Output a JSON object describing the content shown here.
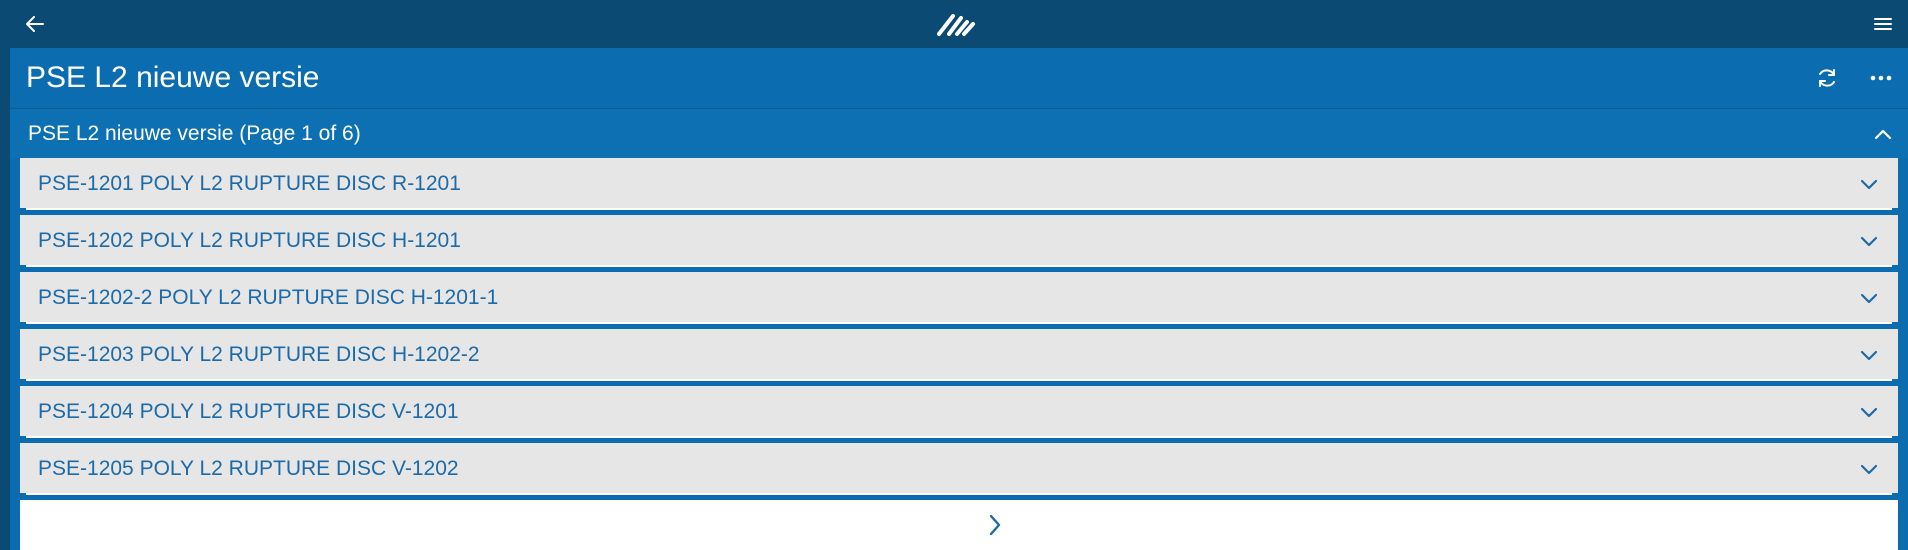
{
  "topbar": {
    "back_icon": "arrow-left-icon",
    "logo_icon": "app-logo",
    "menu_icon": "hamburger-menu-icon"
  },
  "panel": {
    "title": "PSE L2 nieuwe versie",
    "refresh_icon": "refresh-icon",
    "more_icon": "more-horizontal-icon"
  },
  "section": {
    "title": "PSE L2 nieuwe versie (Page 1 of 6)",
    "collapse_icon": "chevron-up-icon",
    "expanded": true
  },
  "items": [
    {
      "label": "PSE-1201 POLY L2 RUPTURE DISC R-1201"
    },
    {
      "label": "PSE-1202 POLY L2 RUPTURE DISC H-1201"
    },
    {
      "label": "PSE-1202-2 POLY L2 RUPTURE DISC H-1201-1"
    },
    {
      "label": "PSE-1203 POLY L2 RUPTURE DISC H-1202-2"
    },
    {
      "label": "PSE-1204 POLY L2 RUPTURE DISC V-1201"
    },
    {
      "label": "PSE-1205 POLY L2 RUPTURE DISC V-1202"
    }
  ],
  "pager": {
    "next_icon": "chevron-right-icon",
    "current_page": 1,
    "total_pages": 6
  },
  "colors": {
    "topbar": "#0a4a73",
    "panel": "#0b6db0",
    "item_bg": "#e6e6e6",
    "item_text": "#1d6aa8"
  }
}
